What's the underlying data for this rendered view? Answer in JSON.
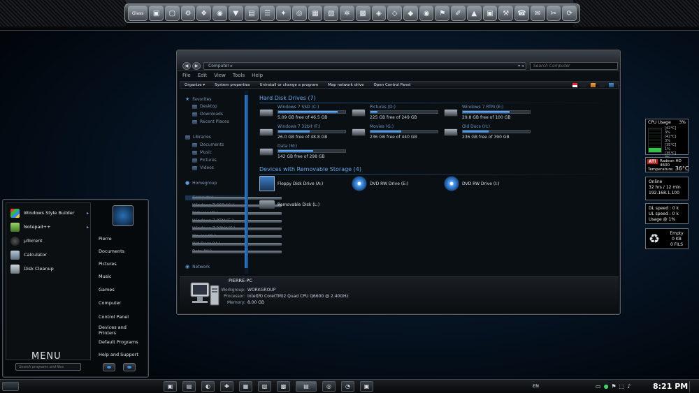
{
  "dock": {
    "items": [
      "Glass",
      "▣",
      "▢",
      "⚙",
      "❖",
      "◉",
      "▼",
      "▤",
      "☰",
      "✦",
      "◎",
      "▦",
      "▧",
      "✲",
      "▩",
      "◈",
      "◇",
      "◆",
      "◉",
      "⚑",
      "✐",
      "▲",
      "▣",
      "⚒",
      "☎",
      "✉",
      "✂",
      "⟳"
    ]
  },
  "explorer": {
    "address": "Computer ▸",
    "search_placeholder": "Search Computer",
    "menu": [
      "File",
      "Edit",
      "View",
      "Tools",
      "Help"
    ],
    "toolbar": [
      "Organize ▾",
      "System properties",
      "Uninstall or change a program",
      "Map network drive",
      "Open Control Panel"
    ],
    "nav": {
      "favorites": "Favorites",
      "favorites_items": [
        "Desktop",
        "Downloads",
        "Recent Places"
      ],
      "libraries": "Libraries",
      "libraries_items": [
        "Documents",
        "Music",
        "Pictures",
        "Videos"
      ],
      "homegroup": "Homegroup",
      "computer": "Computer",
      "computer_items": [
        "Windows 7 SSD (C:)",
        "Pictures (D:)",
        "Windows 7 RTM (E:)",
        "Windows 7 32bit (F:)",
        "Movies (G:)",
        "Old Docs (H:)",
        "Data (M:)"
      ],
      "network": "Network"
    },
    "hdd_header": "Hard Disk Drives (7)",
    "drives": [
      {
        "name": "Windows 7 SSD (C:)",
        "free": "5.09 GB free of 46.5 GB",
        "used_fraction": 0.89
      },
      {
        "name": "Pictures (D:)",
        "free": "225 GB free of 249 GB",
        "used_fraction": 0.1
      },
      {
        "name": "Windows 7 RTM (E:)",
        "free": "29.8 GB free of 100 GB",
        "used_fraction": 0.7
      },
      {
        "name": "Windows 7 32bit (F:)",
        "free": "26.0 GB free of 48.8 GB",
        "used_fraction": 0.47
      },
      {
        "name": "Movies (G:)",
        "free": "236 GB free of 440 GB",
        "used_fraction": 0.46
      },
      {
        "name": "Old Docs (H:)",
        "free": "236 GB free of 390 GB",
        "used_fraction": 0.39
      },
      {
        "name": "Data (M:)",
        "free": "142 GB free of 298 GB",
        "used_fraction": 0.52
      }
    ],
    "removable_header": "Devices with Removable Storage (4)",
    "devices": [
      "Floppy Disk Drive (A:)",
      "DVD RW Drive (E:)",
      "DVD RW Drive (I:)",
      "Removable Disk (L:)"
    ],
    "details": {
      "pc_name": "PIERRE-PC",
      "workgroup_label": "Workgroup:",
      "workgroup": "WORKGROUP",
      "processor_label": "Processor:",
      "processor": "Intel(R) Core(TM)2 Quad CPU   Q6600  @ 2.40GHz",
      "memory_label": "Memory:",
      "memory": "8.00 GB"
    }
  },
  "start_menu": {
    "programs": [
      {
        "label": "Windows Style Builder",
        "arrow": "▸"
      },
      {
        "label": "Notepad++",
        "arrow": "▸"
      },
      {
        "label": "µTorrent",
        "arrow": ""
      },
      {
        "label": "Calculator",
        "arrow": ""
      },
      {
        "label": "Disk Cleanup",
        "arrow": ""
      }
    ],
    "menu_word": "MENU",
    "places": [
      "Pierre",
      "Documents",
      "Pictures",
      "Music",
      "Games",
      "Computer",
      "Control Panel",
      "Devices and Printers",
      "Default Programs",
      "Help and Support"
    ],
    "search_placeholder": "Search programs and files"
  },
  "gadgets": {
    "cpu_title": "CPU Usage",
    "cpu_total": "3%",
    "cores": [
      {
        "temp": "[42°C]",
        "pct": "3%"
      },
      {
        "temp": "[42°C]",
        "pct": "3%"
      },
      {
        "temp": "[35°C]",
        "pct": "1%"
      },
      {
        "temp": "[35°C]",
        "pct": "3%"
      }
    ],
    "gpu_brand": "ATI",
    "gpu_model": "Radeon HD 4600",
    "gpu_temp_label": "Temperature:",
    "gpu_temp": "36°C",
    "net_status": "Online",
    "uptime": "32 hrs / 12 min",
    "ip": "192.168.1.100",
    "dl_speed": "DL speed : 0 k",
    "ul_speed": "UL speed : 0 k",
    "usage": "Usage @ 1%",
    "bin_status": "Empty",
    "bin_size": "0 KB",
    "bin_files": "0 FILS"
  },
  "taskbar": {
    "tasks": [
      "▣",
      "▤",
      "◐",
      "✚",
      "▦",
      "▧",
      "▩",
      "▤",
      "◎",
      "◔",
      "▣"
    ],
    "lang": "EN",
    "tray": [
      "▭",
      "●",
      "⚑",
      "⬚",
      "♪"
    ],
    "clock": "8:21 PM"
  },
  "colors": {
    "accent": "#2d7fd0",
    "link": "#66a9ea",
    "bar_fill": "#4a9ae8"
  }
}
